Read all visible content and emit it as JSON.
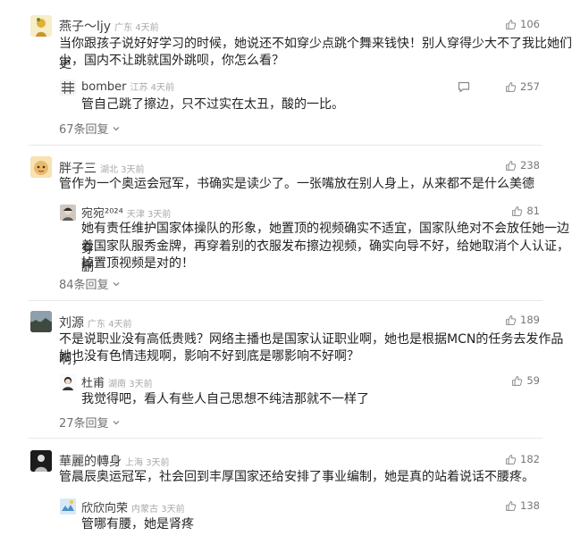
{
  "threads": [
    {
      "user": "燕子～ljy",
      "region": "广东",
      "time": "4天前",
      "likes": "106",
      "text1": "当你跟孩子说好好学习的时候，她说还不如穿少点跳个舞来钱快！别人穿得少大不了我比她们更",
      "text2": "少，国内不让跳就国外跳呗，你怎么看？",
      "reply": {
        "user": "bomber",
        "region": "江苏",
        "time": "4天前",
        "likes": "257",
        "text": "管自己跳了擦边，只不过实在太丑，酸的一比。"
      },
      "more": "67条回复"
    },
    {
      "user": "胖子三",
      "region": "湖北",
      "time": "3天前",
      "likes": "238",
      "text1": "管作为一个奥运会冠军，书确实是读少了。一张嘴放在别人身上，从来都不是什么美德",
      "reply": {
        "user": "宛宛²⁰²⁴",
        "region": "天津",
        "time": "3天前",
        "likes": "81",
        "text1": "她有责任维护国家体操队的形象，她置顶的视频确实不适宜，国家队绝对不会放任她一边穿",
        "text2": "着国家队服秀金牌，再穿着别的衣服发布擦边视频，确实向导不好，给她取消个人认证，删",
        "text3": "掉置顶视频是对的！"
      },
      "more": "84条回复"
    },
    {
      "user": "刘源",
      "region": "广东",
      "time": "4天前",
      "likes": "189",
      "text1": "不是说职业没有高低贵贱？网络主播也是国家认证职业啊，她也是根据MCN的任务去发作品啊，",
      "text2": "她也没有色情违规啊，影响不好到底是哪影响不好啊？",
      "reply": {
        "user": "杜甫",
        "region": "湖南",
        "time": "3天前",
        "likes": "59",
        "text": "我觉得吧，看人有些人自己思想不纯洁那就不一样了"
      },
      "more": "27条回复"
    },
    {
      "user": "華麗的轉身",
      "region": "上海",
      "time": "3天前",
      "likes": "182",
      "text1": "管晨辰奥运冠军，社会回到丰厚国家还给安排了事业编制，她是真的站着说话不腰疼。",
      "reply": {
        "user": "欣欣向荣",
        "region": "内蒙古",
        "time": "3天前",
        "likes": "138",
        "text": "管哪有腰，她是肾疼"
      }
    }
  ],
  "icons": {
    "like": "thumbs-up-icon",
    "reply": "comment-icon",
    "more": "chevron-down-icon"
  }
}
